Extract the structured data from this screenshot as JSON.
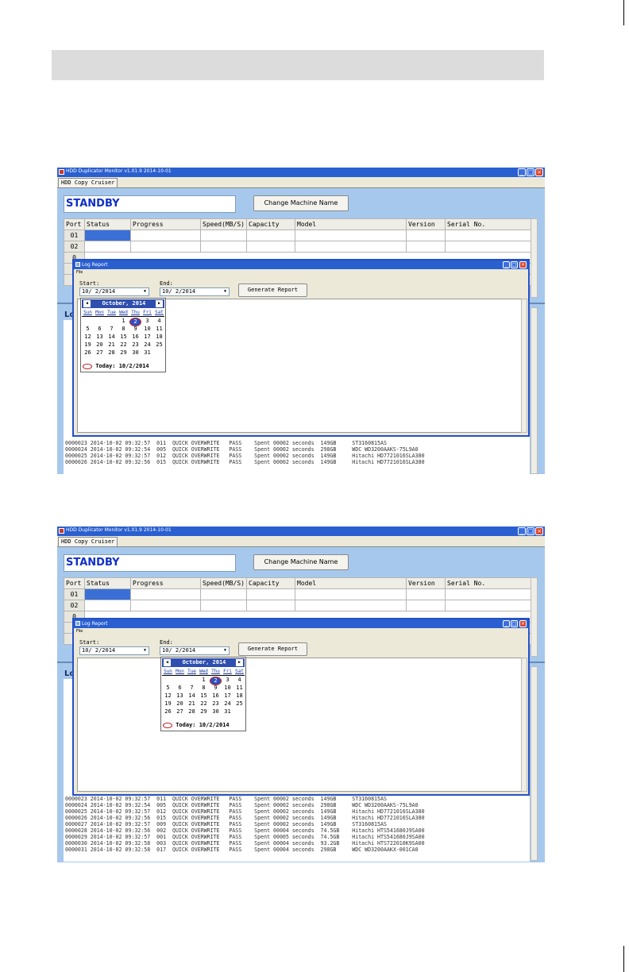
{
  "app": {
    "title": "HDD Duplicator Monitor v1.01.9 2014-10-01",
    "tab": "HDD Copy Cruiser",
    "status": "STANDBY",
    "change_name_button": "Change Machine Name",
    "log_label": "Lo",
    "window_controls": {
      "minimize": "_",
      "maximize": "□",
      "close": "×"
    }
  },
  "ports_table": {
    "headers": [
      "Port",
      "Status",
      "Progress",
      "Speed(MB/S)",
      "Capacity",
      "Model",
      "Version",
      "Serial No."
    ],
    "rows": [
      "01",
      "02"
    ],
    "partial_labels": [
      "0",
      "0",
      "0"
    ]
  },
  "log_report": {
    "title": "Log Report",
    "menu": "File",
    "start_label": "Start:",
    "end_label": "End:",
    "start_value": "10/ 2/2014",
    "end_value": "10/ 2/2014",
    "generate_button": "Generate Report"
  },
  "calendar": {
    "month": "October, 2014",
    "prev": "◀",
    "next": "▶",
    "dows": [
      "Sun",
      "Mon",
      "Tue",
      "Wed",
      "Thu",
      "Fri",
      "Sat"
    ],
    "weeks": [
      [
        "",
        "",
        "",
        "1",
        "2",
        "3",
        "4"
      ],
      [
        "5",
        "6",
        "7",
        "8",
        "9",
        "10",
        "11"
      ],
      [
        "12",
        "13",
        "14",
        "15",
        "16",
        "17",
        "18"
      ],
      [
        "19",
        "20",
        "21",
        "22",
        "23",
        "24",
        "25"
      ],
      [
        "26",
        "27",
        "28",
        "29",
        "30",
        "31",
        ""
      ]
    ],
    "selected": "2",
    "today": "Today: 10/2/2014"
  },
  "log_lines_1": [
    "0000023 2014-10-02 09:32:57  011  QUICK OVERWRITE   PASS    Spent 00002 seconds  149GB     ST3160815AS",
    "0000024 2014-10-02 09:32:54  005  QUICK OVERWRITE   PASS    Spent 00002 seconds  298GB     WDC WD3200AAKS-75L9A0",
    "0000025 2014-10-02 09:32:57  012  QUICK OVERWRITE   PASS    Spent 00002 seconds  149GB     Hitachi HD7721016SLA380",
    "0000026 2014-10-02 09:32:56  015  QUICK OVERWRITE   PASS    Spent 00002 seconds  149GB     Hitachi HD7721016SLA380"
  ],
  "log_lines_2": [
    "0000023 2014-10-02 09:32:57  011  QUICK OVERWRITE   PASS    Spent 00002 seconds  149GB     ST3160815AS",
    "0000024 2014-10-02 09:32:54  005  QUICK OVERWRITE   PASS    Spent 00002 seconds  298GB     WDC WD3200AAKS-75L9A0",
    "0000025 2014-10-02 09:32:57  012  QUICK OVERWRITE   PASS    Spent 00002 seconds  149GB     Hitachi HD7721016SLA380",
    "0000026 2014-10-02 09:32:56  015  QUICK OVERWRITE   PASS    Spent 00002 seconds  149GB     Hitachi HD7721016SLA380",
    "0000027 2014-10-02 09:32:57  009  QUICK OVERWRITE   PASS    Spent 00002 seconds  149GB     ST3160815AS",
    "0000028 2014-10-02 09:32:56  002  QUICK OVERWRITE   PASS    Spent 00004 seconds  74.5GB    Hitachi HTS541680J9SA00",
    "0000029 2014-10-02 09:32:57  001  QUICK OVERWRITE   PASS    Spent 00005 seconds  74.5GB    Hitachi HTS541680J9SA00",
    "0000030 2014-10-02 09:32:58  003  QUICK OVERWRITE   PASS    Spent 00004 seconds  93.2GB    Hitachi HTS722010K9SA00",
    "0000031 2014-10-02 09:32:58  017  QUICK OVERWRITE   PASS    Spent 00004 seconds  298GB     WDC WD3200AAKX-001CA0"
  ]
}
